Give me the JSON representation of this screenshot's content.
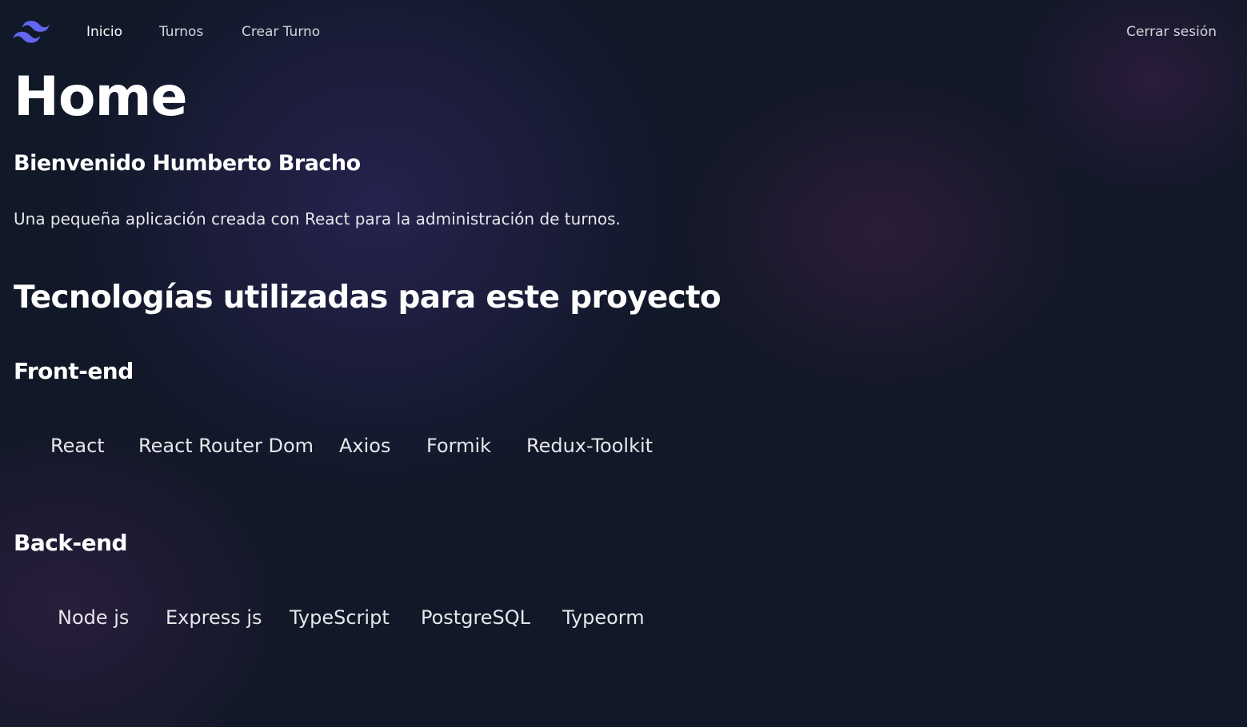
{
  "colors": {
    "background": "#111827",
    "accent": "#6366f1",
    "text": "#ffffff",
    "muted_text": "#d1d5db"
  },
  "nav": {
    "logo_icon": "tailwind-wave-icon",
    "links": [
      {
        "label": "Inicio",
        "active": true
      },
      {
        "label": "Turnos",
        "active": false
      },
      {
        "label": "Crear Turno",
        "active": false
      }
    ],
    "logout_label": "Cerrar sesión"
  },
  "main": {
    "title": "Home",
    "welcome": "Bienvenido Humberto Bracho",
    "description": "Una pequeña aplicación creada con React para la administración de turnos.",
    "technologies_title": "Tecnologías utilizadas para este proyecto",
    "frontend": {
      "title": "Front-end",
      "items": [
        "React",
        "React Router Dom",
        "Axios",
        "Formik",
        "Redux-Toolkit"
      ]
    },
    "backend": {
      "title": "Back-end",
      "items": [
        "Node js",
        "Express js",
        "TypeScript",
        "PostgreSQL",
        "Typeorm"
      ]
    }
  }
}
